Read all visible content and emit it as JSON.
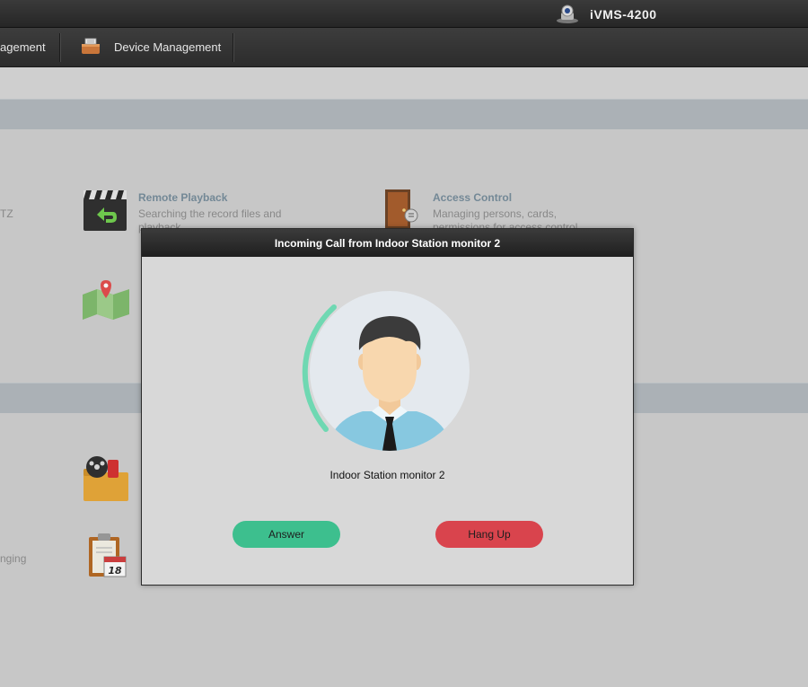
{
  "window": {
    "title": "iVMS-4200"
  },
  "menu": {
    "items": [
      {
        "label": "agement"
      },
      {
        "label": "Device Management"
      }
    ]
  },
  "features": {
    "remote_playback": {
      "title": "Remote Playback",
      "desc_line1": "Searching the record files and",
      "desc_line2": "playback."
    },
    "access_control": {
      "title": "Access Control",
      "desc_line1": "Managing persons, cards,",
      "desc_line2": "permissions for access control."
    },
    "fragments": {
      "tz": "TZ",
      "ging": "nging"
    }
  },
  "dialog": {
    "title": "Incoming Call from Indoor Station monitor 2",
    "caller": "Indoor Station monitor 2",
    "answer_label": "Answer",
    "hangup_label": "Hang Up"
  },
  "icons": {
    "app": "camera-icon",
    "device_management": "toolbox-icon",
    "remote_playback": "clapperboard-icon",
    "access_control": "door-icon",
    "map": "map-pin-icon",
    "event": "film-folder-icon",
    "schedule": "calendar-icon",
    "avatar": "person-avatar-icon"
  },
  "colors": {
    "answer": "#3dbf8e",
    "hangup": "#d9444d",
    "ring": "#6fd8b2",
    "header": "#2b2b2b"
  }
}
